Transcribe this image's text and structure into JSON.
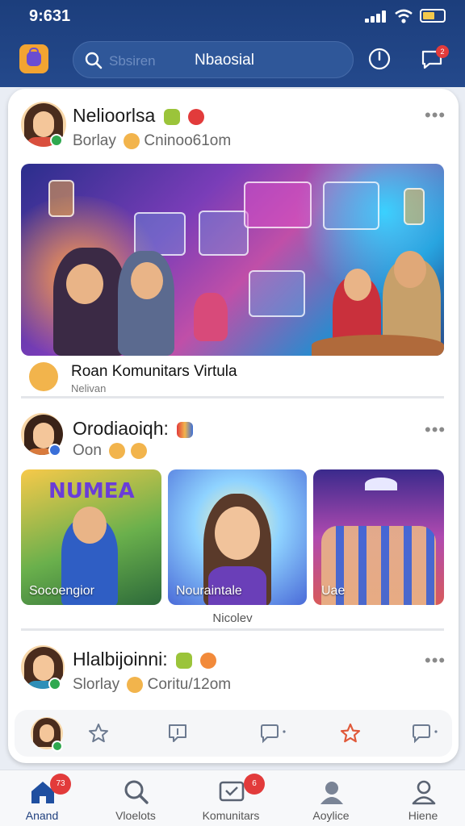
{
  "status": {
    "time": "9:631"
  },
  "header": {
    "search_placeholder": "Sbsiren",
    "search_value": "Nbaosial",
    "notif_count": "2"
  },
  "posts": [
    {
      "title": "Nelioorlsa",
      "subtitle": "Borlay",
      "subtitle_tail": "Cninoo61om"
    },
    {
      "title": "Orodiaoiqh:",
      "subtitle": "Oon"
    },
    {
      "title": "Hlalbijoinni:",
      "subtitle": "Slorlay",
      "subtitle_tail": "Coritu/12om"
    }
  ],
  "hero_caption": {
    "title": "Roan Komunitars Virtula",
    "sub": "Nelivan"
  },
  "thumbnails": [
    {
      "label": "Socoengior",
      "banner": "NUMEA"
    },
    {
      "label": "Nouraintale"
    },
    {
      "label": "Uae"
    }
  ],
  "thumbs_caption": "Nicolev",
  "nav": {
    "items": [
      {
        "label": "Anand",
        "badge": "73"
      },
      {
        "label": "Vloelots"
      },
      {
        "label": "Komunitars",
        "badge": "6"
      },
      {
        "label": "Aoylice"
      },
      {
        "label": "Hiene"
      }
    ]
  },
  "colors": {
    "header": "#1c3e7c",
    "badge": "#e23b3b",
    "accent": "#2f5799"
  }
}
